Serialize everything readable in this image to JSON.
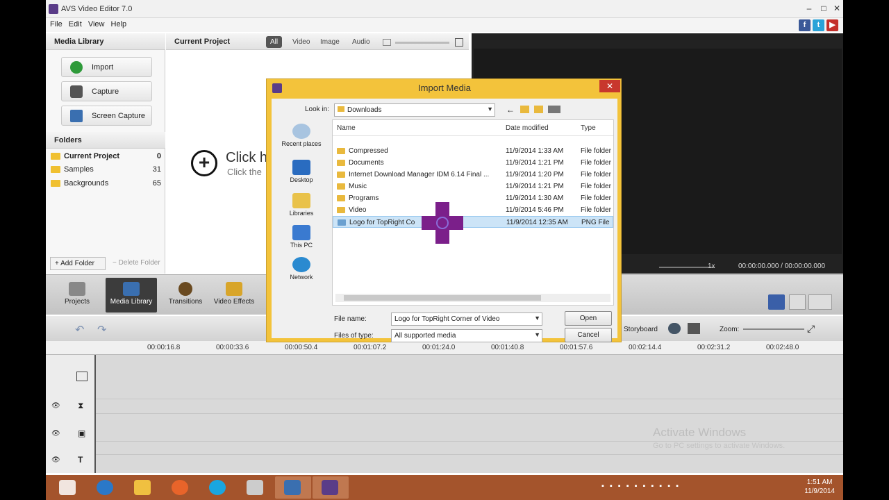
{
  "window": {
    "title": "AVS Video Editor 7.0"
  },
  "menu": [
    "File",
    "Edit",
    "View",
    "Help"
  ],
  "media_library": {
    "header": "Media Library",
    "buttons": [
      {
        "label": "Import",
        "icon": "plus-circle-icon"
      },
      {
        "label": "Capture",
        "icon": "camera-icon"
      },
      {
        "label": "Screen Capture",
        "icon": "monitor-icon"
      }
    ],
    "folders_header": "Folders",
    "folders": [
      {
        "name": "Current Project",
        "count": "0"
      },
      {
        "name": "Samples",
        "count": "31"
      },
      {
        "name": "Backgrounds",
        "count": "65"
      }
    ],
    "add_folder": "Add Folder",
    "delete_folder": "Delete Folder"
  },
  "project": {
    "header": "Current Project",
    "filters": [
      "All",
      "Video",
      "Image",
      "Audio"
    ],
    "active_filter": "All",
    "click_here": "Click h",
    "click_sub": "Click the"
  },
  "preview": {
    "speed": "1x",
    "time": "00:00:00.000 / 00:00:00.000"
  },
  "toolbar": {
    "buttons": [
      "Projects",
      "Media Library",
      "Transitions",
      "Video Effects"
    ],
    "active": "Media Library",
    "storyboard": "Storyboard",
    "zoom": "Zoom:"
  },
  "timeline": {
    "marks": [
      "00:00:16.8",
      "00:00:33.6",
      "00:00:50.4",
      "00:01:07.2",
      "00:01:24.0",
      "00:01:40.8",
      "00:01:57.6",
      "00:02:14.4",
      "00:02:31.2",
      "00:02:48.0"
    ]
  },
  "watermark": {
    "line1": "Activate Windows",
    "line2": "Go to PC settings to activate Windows."
  },
  "dialog": {
    "title": "Import Media",
    "look_in_label": "Look in:",
    "look_in_value": "Downloads",
    "places": [
      "Recent places",
      "Desktop",
      "Libraries",
      "This PC",
      "Network"
    ],
    "columns": [
      "Name",
      "Date modified",
      "Type"
    ],
    "files": [
      {
        "name": "Compressed",
        "date": "11/9/2014 1:33 AM",
        "type": "File folder"
      },
      {
        "name": "Documents",
        "date": "11/9/2014 1:21 PM",
        "type": "File folder"
      },
      {
        "name": "Internet Download Manager IDM 6.14 Final ...",
        "date": "11/9/2014 1:20 PM",
        "type": "File folder"
      },
      {
        "name": "Music",
        "date": "11/9/2014 1:21 PM",
        "type": "File folder"
      },
      {
        "name": "Programs",
        "date": "11/9/2014 1:30 AM",
        "type": "File folder"
      },
      {
        "name": "Video",
        "date": "11/9/2014 5:46 PM",
        "type": "File folder"
      },
      {
        "name": "Logo for TopRight Co",
        "date": "11/9/2014 12:35 AM",
        "type": "PNG File",
        "selected": true
      }
    ],
    "file_name_label": "File name:",
    "file_name_value": "Logo for TopRight Corner of Video",
    "file_type_label": "Files of type:",
    "file_type_value": "All supported media",
    "open": "Open",
    "cancel": "Cancel"
  },
  "taskbar": {
    "apps": [
      "windows-start-icon",
      "internet-explorer-icon",
      "file-explorer-icon",
      "firefox-icon",
      "skype-icon",
      "app-icon",
      "monitor-icon",
      "video-editor-icon"
    ],
    "time": "1:51 AM",
    "date": "11/9/2014"
  },
  "colors": {
    "dialog_frame": "#f3c33b",
    "taskbar": "#a4542c",
    "cursor_overlay": "#7b1f8a",
    "selection": "#cce4f7"
  }
}
